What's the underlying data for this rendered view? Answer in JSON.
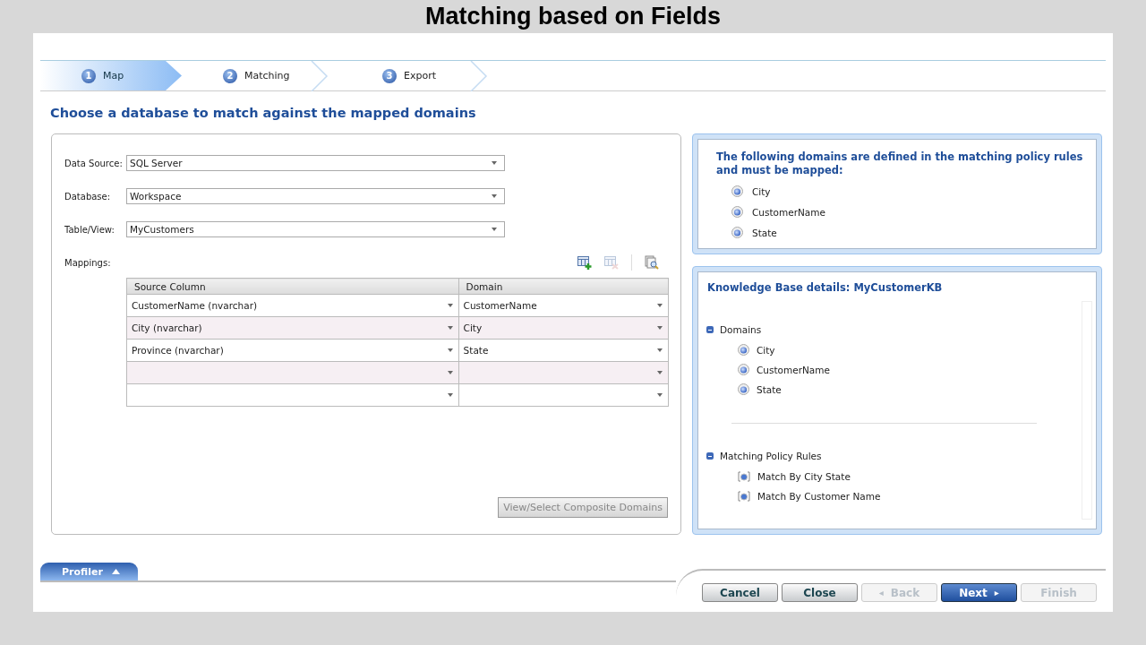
{
  "slide_title": "Matching based on Fields",
  "wizard_steps": [
    {
      "number": "1",
      "label": "Map",
      "selected": true
    },
    {
      "number": "2",
      "label": "Matching",
      "selected": false
    },
    {
      "number": "3",
      "label": "Export",
      "selected": false
    }
  ],
  "heading": "Choose a database to match against the mapped domains",
  "source_form": {
    "fields": [
      {
        "label": "Data Source:",
        "value": "SQL Server"
      },
      {
        "label": "Database:",
        "value": "Workspace"
      },
      {
        "label": "Table/View:",
        "value": "MyCustomers"
      }
    ],
    "mappings_label": "Mappings:",
    "toolbar": [
      {
        "kind": "add",
        "disabled": false
      },
      {
        "kind": "remove",
        "disabled": true
      },
      {
        "kind": "preview",
        "disabled": false
      }
    ],
    "mappings_table": {
      "columns": [
        "Source Column",
        "Domain"
      ],
      "rows": [
        {
          "source": "CustomerName (nvarchar)",
          "domain": "CustomerName"
        },
        {
          "source": "City (nvarchar)",
          "domain": "City"
        },
        {
          "source": "Province (nvarchar)",
          "domain": "State"
        },
        {},
        {}
      ]
    },
    "composite_button": {
      "label": "View/Select Composite Domains",
      "disabled": true
    }
  },
  "required_domains": {
    "heading": "The following domains are defined in the matching policy rules and must be mapped:",
    "items": [
      "City",
      "CustomerName",
      "State"
    ]
  },
  "kb_details": {
    "title": "Knowledge Base details: MyCustomerKB",
    "groups": [
      {
        "label": "Domains",
        "kind": "domain",
        "expanded": true,
        "children": [
          "City",
          "CustomerName",
          "State"
        ]
      },
      {
        "label": "Matching Policy Rules",
        "kind": "rule",
        "expanded": true,
        "children": [
          "Match By City State",
          "Match By Customer Name"
        ]
      }
    ]
  },
  "profiler_tab": {
    "label": "Profiler"
  },
  "buttons": [
    {
      "label": "Cancel",
      "kind": "normal",
      "disabled": false
    },
    {
      "label": "Close",
      "kind": "normal",
      "disabled": false
    },
    {
      "label": "Back",
      "kind": "normal",
      "disabled": true,
      "arrow_before": "◂"
    },
    {
      "label": "Next",
      "kind": "primary",
      "disabled": false,
      "arrow_after": "▸"
    },
    {
      "label": "Finish",
      "kind": "normal",
      "disabled": true
    }
  ]
}
